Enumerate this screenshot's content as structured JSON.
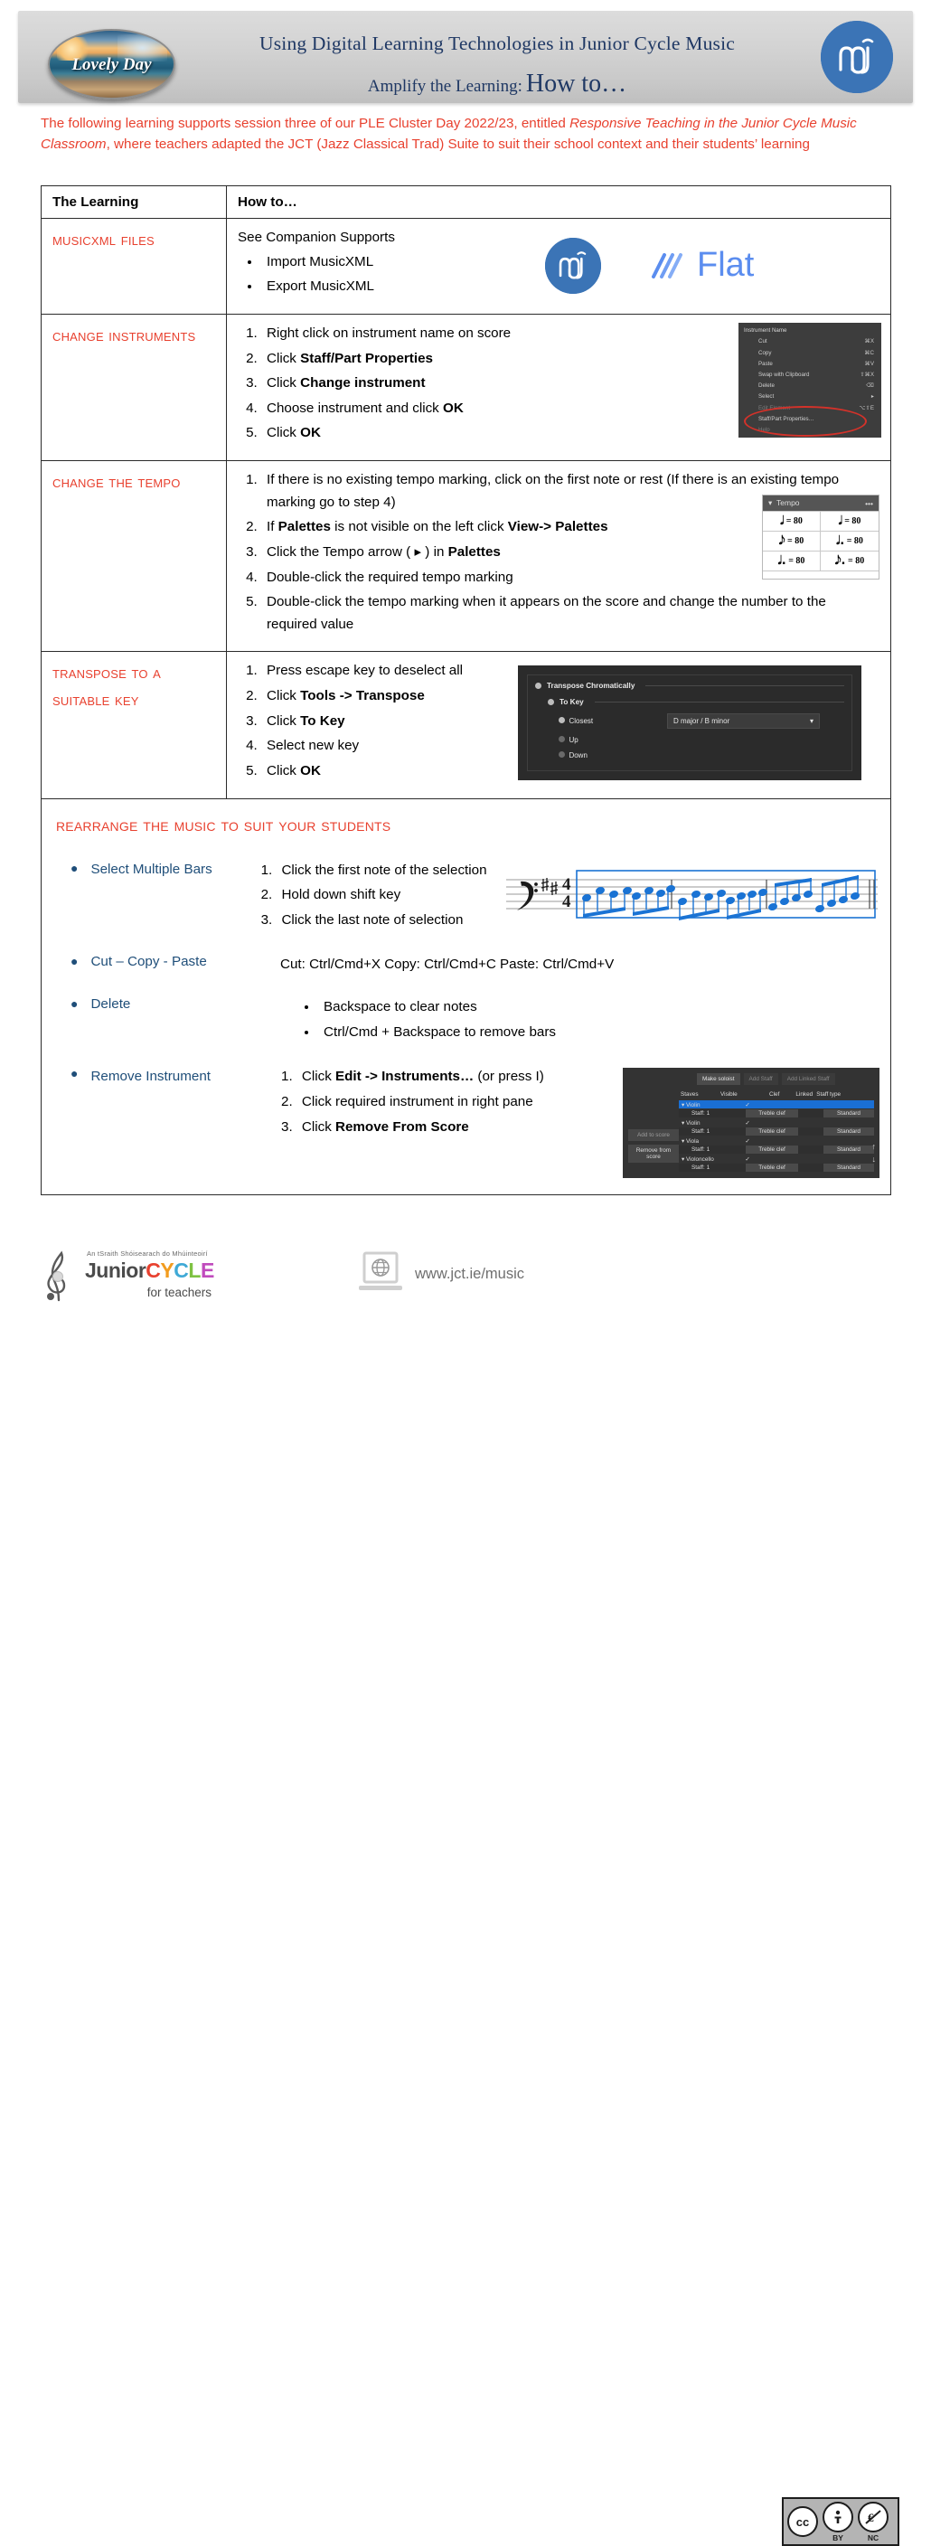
{
  "header": {
    "logo_text": "Lovely Day",
    "title": "Using Digital Learning Technologies in Junior Cycle Music",
    "subtitle_lead": "Amplify the Learning:",
    "subtitle_main": "How to…",
    "right_logo_name": "musescore-logo"
  },
  "intro": {
    "part1": "The following learning supports session three of our PLE Cluster Day 2022/23, entitled ",
    "italic1": "Responsive Teaching in the Junior Cycle Music Classroom",
    "part2": ", where teachers adapted the JCT (Jazz Classical Trad) Suite to suit their school context and their students’ learning"
  },
  "table": {
    "headers": {
      "learning": "The Learning",
      "howto": "How to…"
    },
    "rows": [
      {
        "id": "musicxml-files",
        "title": "MusicXML Files",
        "lead": "See Companion Supports",
        "bullets": [
          "Import MusicXML",
          "Export MusicXML"
        ],
        "logos": [
          "musescore-logo",
          "flat-logo"
        ],
        "flat_label": "Flat"
      },
      {
        "id": "change-instruments",
        "title": "Change Instruments",
        "steps": [
          {
            "pre": "Right click on instrument name on score",
            "bold": "",
            "post": ""
          },
          {
            "pre": "Click ",
            "bold": "Staff/Part Properties",
            "post": ""
          },
          {
            "pre": "Click ",
            "bold": "Change instrument",
            "post": ""
          },
          {
            "pre": "Choose instrument and click ",
            "bold": "OK",
            "post": ""
          },
          {
            "pre": "Click ",
            "bold": "OK",
            "post": ""
          }
        ],
        "context_menu": {
          "title": "Instrument Name",
          "items": [
            {
              "label": "Cut",
              "key": "⌘X",
              "dim": false
            },
            {
              "label": "Copy",
              "key": "⌘C",
              "dim": false
            },
            {
              "label": "Paste",
              "key": "⌘V",
              "dim": false
            },
            {
              "label": "Swap with Clipboard",
              "key": "⇧⌘X",
              "dim": false
            },
            {
              "label": "Delete",
              "key": "⌫",
              "dim": false
            },
            {
              "label": "Select",
              "key": "▸",
              "dim": false
            },
            {
              "label": "Edit Element",
              "key": "⌥⇧E",
              "dim": true
            },
            {
              "label": "Staff/Part Properties…",
              "key": "",
              "dim": false
            },
            {
              "label": "Help",
              "key": "",
              "dim": true
            }
          ]
        }
      },
      {
        "id": "change-tempo",
        "title": "Change the Tempo",
        "steps": [
          {
            "pre": "If there is no existing tempo marking, click on the first note or rest (If there is an existing tempo marking go to step 4)",
            "bold": "",
            "post": ""
          },
          {
            "pre": "If ",
            "bold": "Palettes",
            "post": " is not visible on the left click ",
            "bold2": "View-> Palettes"
          },
          {
            "pre": "Click the Tempo arrow ( ▸ ) in ",
            "bold": "Palettes",
            "post": ""
          },
          {
            "pre": "Double-click the required tempo marking",
            "bold": "",
            "post": ""
          },
          {
            "pre": "Double-click the tempo marking when it appears on the score and change the number to the required value",
            "bold": "",
            "post": ""
          }
        ],
        "tempo_palette": {
          "title": "Tempo",
          "menu_glyph": "•••",
          "cells": [
            {
              "note": "𝅗𝅥",
              "value": "= 80"
            },
            {
              "note": "𝅘𝅥",
              "value": "= 80"
            },
            {
              "note": "𝅘𝅥𝅮",
              "value": "= 80"
            },
            {
              "note": "𝅗𝅥.",
              "value": "= 80"
            },
            {
              "note": "𝅘𝅥.",
              "value": "= 80"
            },
            {
              "note": "𝅘𝅥𝅮.",
              "value": "= 80"
            }
          ]
        }
      },
      {
        "id": "transpose",
        "title": "Transpose to a suitable key",
        "steps": [
          {
            "pre": "Press escape key to deselect all",
            "bold": "",
            "post": ""
          },
          {
            "pre": "Click ",
            "bold": "Tools -> Transpose",
            "post": ""
          },
          {
            "pre": "Click ",
            "bold": "To Key",
            "post": ""
          },
          {
            "pre": "Select new key",
            "bold": "",
            "post": ""
          },
          {
            "pre": "Click ",
            "bold": "OK",
            "post": ""
          }
        ],
        "transpose_dialog": {
          "heading": "Transpose Chromatically",
          "section": "To Key",
          "options": [
            "Closest",
            "Up",
            "Down"
          ],
          "selected_option": "Closest",
          "key_value": "D major / B minor"
        }
      }
    ],
    "rearrange": {
      "title": "Rearrange the music to suit your students",
      "items": [
        {
          "label": "Select Multiple Bars",
          "steps": [
            "Click the first note of the selection",
            "Hold down shift key",
            "Click the last note of selection"
          ],
          "image": "music-staff-selection"
        },
        {
          "label": "Cut – Copy - Paste",
          "text": "Cut: Ctrl/Cmd+X   Copy: Ctrl/Cmd+C  Paste: Ctrl/Cmd+V"
        },
        {
          "label": "Delete",
          "bullets": [
            "Backspace to clear notes",
            "Ctrl/Cmd + Backspace to remove bars"
          ]
        },
        {
          "label": "Remove Instrument",
          "steps_rich": [
            {
              "pre": "Click ",
              "bold": "Edit -> Instruments…",
              "post": " (or press I)"
            },
            {
              "pre": "Click required instrument in right pane",
              "bold": "",
              "post": ""
            },
            {
              "pre": "Click ",
              "bold": "Remove From Score",
              "post": ""
            }
          ],
          "instruments_dialog": {
            "buttons": [
              "Make soloist",
              "Add Staff",
              "Add Linked Staff"
            ],
            "left_buttons": [
              "Add to score",
              "Remove from score"
            ],
            "columns": [
              "Staves",
              "Visible",
              "Clef",
              "Linked",
              "Staff type"
            ],
            "rows": [
              {
                "name": "Violin",
                "visible": "✓",
                "selected": true,
                "group": true
              },
              {
                "name": "Staff: 1",
                "clef": "Treble clef",
                "stafftype": "Standard",
                "indent": true
              },
              {
                "name": "Violin",
                "visible": "✓",
                "group": true
              },
              {
                "name": "Staff: 1",
                "clef": "Treble clef",
                "stafftype": "Standard",
                "indent": true
              },
              {
                "name": "Viola",
                "visible": "✓",
                "group": true
              },
              {
                "name": "Staff: 1",
                "clef": "Treble clef",
                "stafftype": "Standard",
                "indent": true
              },
              {
                "name": "Violoncello",
                "visible": "✓",
                "group": true
              },
              {
                "name": "Staff: 1",
                "clef": "Treble clef",
                "stafftype": "Standard",
                "indent": true
              }
            ]
          }
        }
      ]
    }
  },
  "footer": {
    "jc_tagline": "An tSraith Shóisearach do Mhúinteoirí",
    "jc_junior": "Junior",
    "jc_cycle": [
      "C",
      "Y",
      "C",
      "L",
      "E"
    ],
    "jc_for_teachers": "for teachers",
    "website": "www.jct.ie/music",
    "cc": {
      "cc": "cc",
      "by": "BY",
      "nc": "NC"
    }
  },
  "colors": {
    "heading_red": "#e8412f",
    "title_navy": "#1f3864",
    "link_blue": "#1f4e79",
    "musescore_blue": "#3b74b6",
    "flat_blue": "#5b8def",
    "selection_blue": "#1a6fd4"
  }
}
